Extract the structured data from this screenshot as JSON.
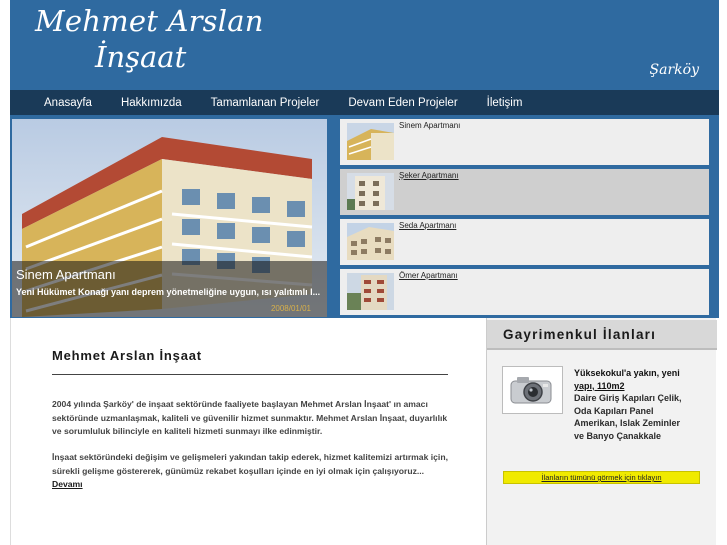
{
  "header": {
    "logo_line1": "Mehmet Arslan",
    "logo_line2": "İnşaat",
    "city": "Şarköy"
  },
  "nav": {
    "items": [
      {
        "label": "Anasayfa"
      },
      {
        "label": "Hakkımızda"
      },
      {
        "label": "Tamamlanan Projeler"
      },
      {
        "label": "Devam Eden Projeler"
      },
      {
        "label": "İletişim"
      }
    ]
  },
  "slider": {
    "featured": {
      "title": "Sinem Apartmanı",
      "description": "Yeni Hükümet Konağı yanı deprem yönetmeliğine uygun, ısı yalıtımlı l...",
      "date": "2008/01/01"
    },
    "thumbs": [
      {
        "label": "Sinem Apartmanı"
      },
      {
        "label": "Şeker Apartmanı"
      },
      {
        "label": "Seda Apartmanı"
      },
      {
        "label": "Ömer Apartmanı"
      }
    ]
  },
  "main": {
    "title": "Mehmet Arslan İnşaat",
    "paragraph1": "2004 yılında Şarköy' de inşaat sektöründe faaliyete başlayan Mehmet Arslan İnşaat' ın amacı sektöründe uzmanlaşmak, kaliteli ve güvenilir hizmet sunmaktır. Mehmet Arslan İnşaat, duyarlılık ve sorumluluk bilinciyle en kaliteli hizmeti sunmayı ilke edinmiştir.",
    "paragraph2": "İnşaat sektöründeki değişim ve gelişmeleri yakından takip ederek, hizmet kalitemizi artırmak için, sürekli gelişme göstererek, günümüz rekabet koşulları içinde en iyi olmak için çalışıyoruz...",
    "more_link": "Devamı"
  },
  "sidebar": {
    "title": "Gayrimenkul İlanları",
    "ad": {
      "title_part1": "Yüksekokul'a yakın, yeni",
      "title_part2": "yapı, 110m2",
      "description": "Daire Giriş Kapıları Çelik, Oda Kapıları Panel Amerikan, Islak Zeminler ve Banyo Çanakkale",
      "image_icon": "camera-icon"
    },
    "all_link": "İlanların tümünü görmek için tıklayın"
  },
  "colors": {
    "header_blue": "#2f6aa0",
    "nav_dark": "#1a3a58",
    "link_yellow": "#f0ea00",
    "date_gold": "#d8b04a"
  }
}
